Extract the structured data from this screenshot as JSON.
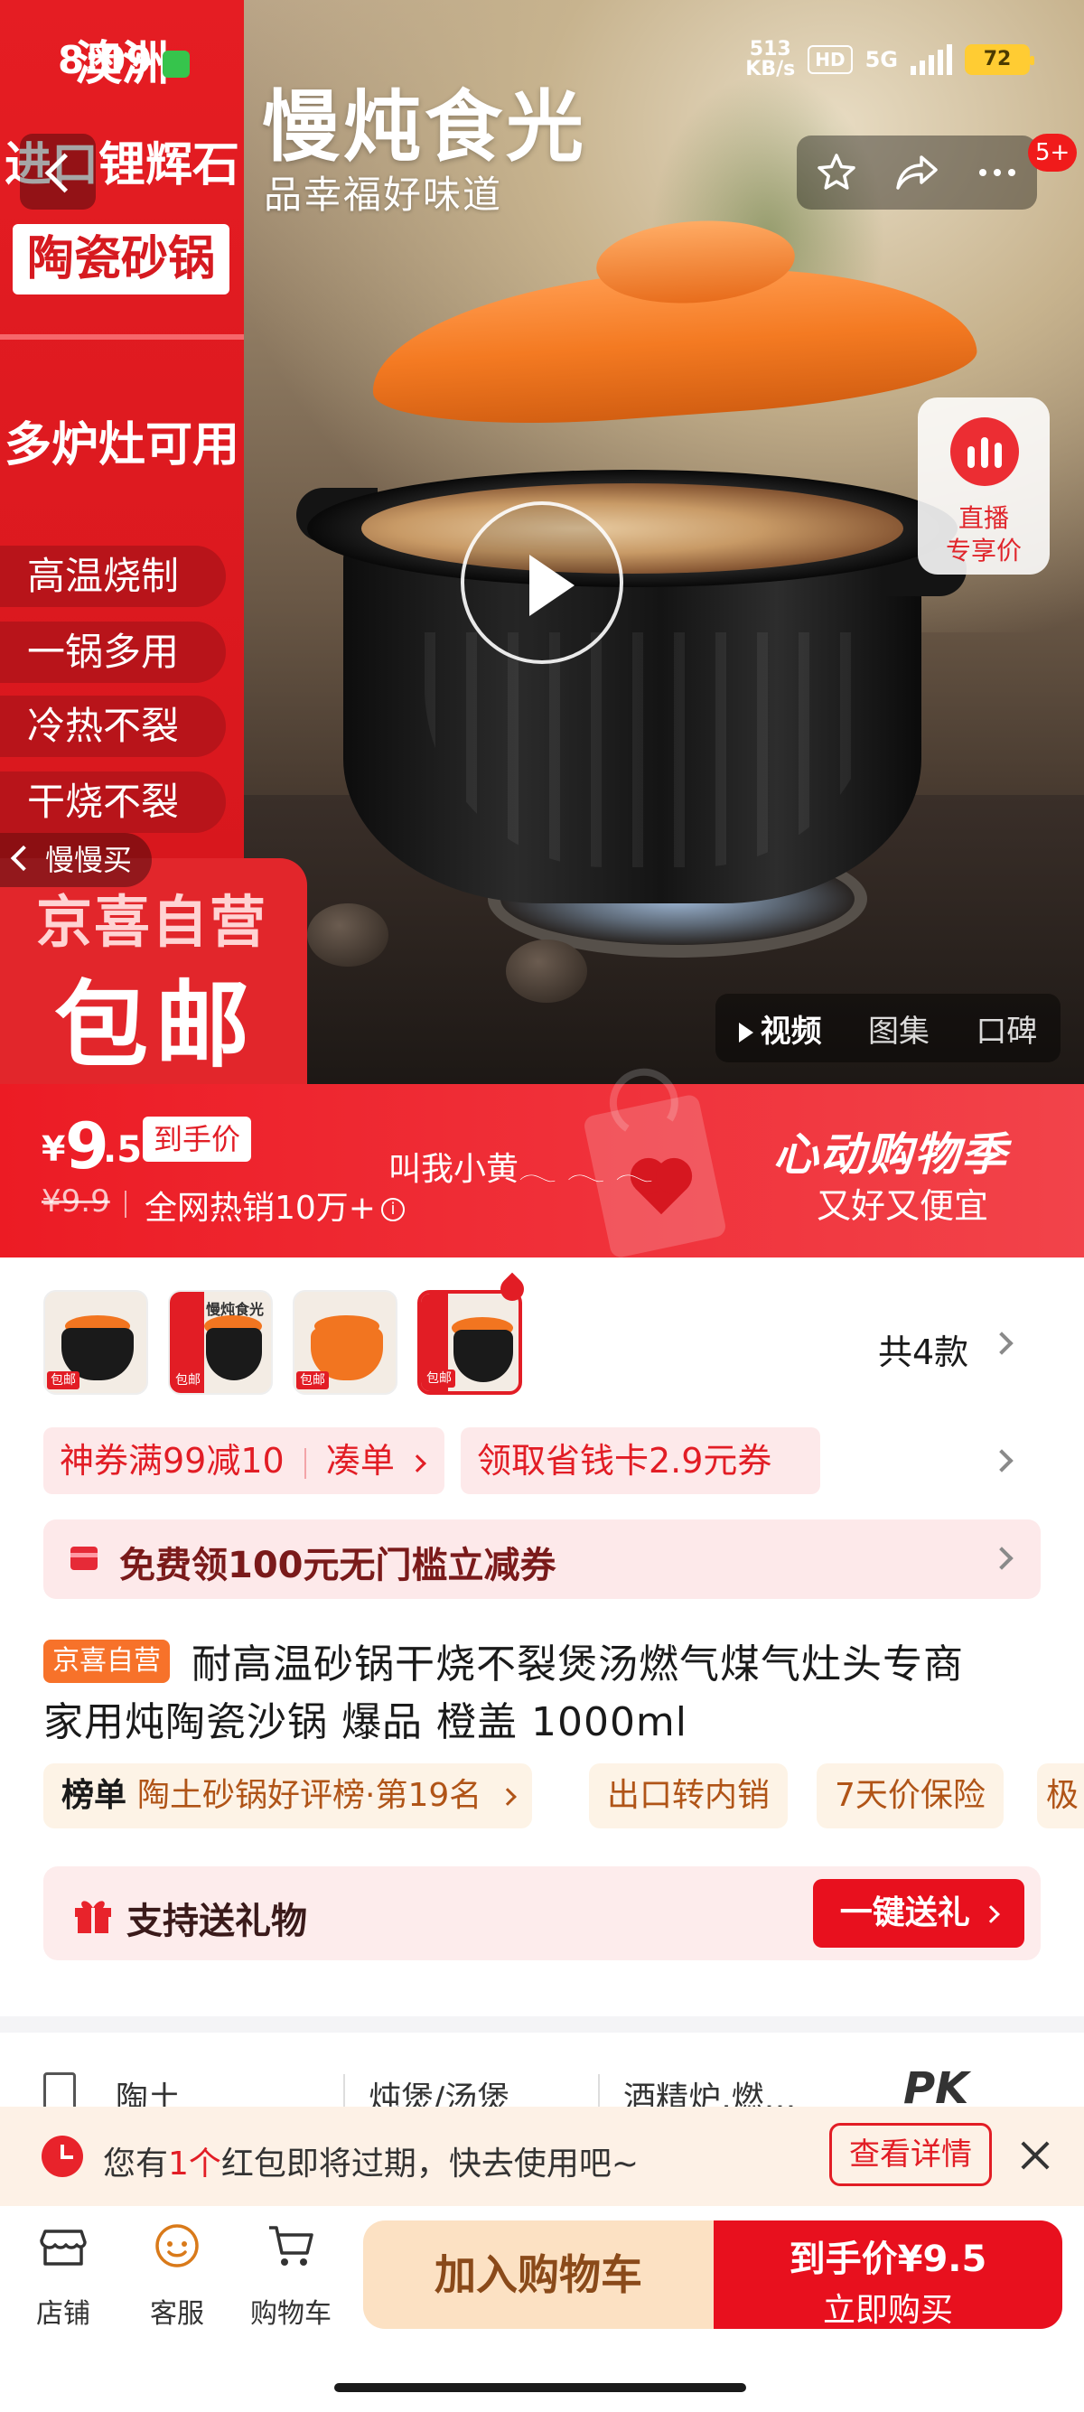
{
  "status_bar": {
    "time": "8:09",
    "net_speed_value": "513",
    "net_speed_unit": "KB/s",
    "hd": "HD",
    "network": "5G",
    "battery": "72"
  },
  "hero": {
    "title": "慢炖食光",
    "subtitle": "品幸福好味道",
    "promo_origin_line1": "澳洲",
    "promo_origin_line2": "进口锂辉石",
    "promo_tag": "陶瓷砂锅",
    "promo_multi": "多炉灶可用",
    "features": [
      "高温烧制",
      "一锅多用",
      "冷热不裂",
      "干烧不裂"
    ],
    "slow_buy": "慢慢买",
    "promo_brand": "京喜自营",
    "promo_free_shipping": "包邮",
    "notification_badge": "5+",
    "live_line1": "直播",
    "live_line2": "专享价",
    "media_tabs": [
      "视频",
      "图集",
      "口碑"
    ]
  },
  "price": {
    "currency": "¥",
    "integer": "9",
    "decimal": ".5",
    "tag": "到手价",
    "original": "¥9.9",
    "sales": "全网热销10万+",
    "overlay_name": "叫我小黄𓂃 𓂃 𓂃",
    "season_title": "心动购物季",
    "season_sub": "又好又便宜"
  },
  "variants": {
    "count_label": "共4款",
    "thumb_label": "包邮",
    "thumb_text": "慢炖食光"
  },
  "coupons": {
    "chip1_main": "神券满99减10",
    "chip1_action": "凑单",
    "chip2": "领取省钱卡2.9元券",
    "free_coupon": "免费领100元无门槛立减券"
  },
  "product": {
    "badge": "京喜自营",
    "title_line1": "耐高温砂锅干烧不裂煲汤燃气煤气灶头专商",
    "title_line2": "家用炖陶瓷沙锅 爆品 橙盖 1000ml"
  },
  "rank": {
    "label": "榜单",
    "text": "陶土砂锅好评榜·第19名",
    "chips": [
      "出口转内销",
      "7天价保险",
      "极"
    ]
  },
  "gift": {
    "text": "支持送礼物",
    "button": "一键送礼"
  },
  "params": {
    "items": [
      "陶土",
      "炖煲/汤煲",
      "酒精炉,燃…"
    ],
    "pk": "PK"
  },
  "notice": {
    "prefix": "您有",
    "count": "1个",
    "suffix": "红包即将过期，快去使用吧~",
    "button": "查看详情"
  },
  "bottom_bar": {
    "tabs": [
      "店铺",
      "客服",
      "购物车"
    ],
    "add_to_cart": "加入购物车",
    "buy_line1": "到手价¥9.5",
    "buy_line2": "立即购买"
  },
  "colors": {
    "brand_red": "#e8101e",
    "lid_orange": "#f47a22",
    "cart_bg": "#fce1c3"
  }
}
